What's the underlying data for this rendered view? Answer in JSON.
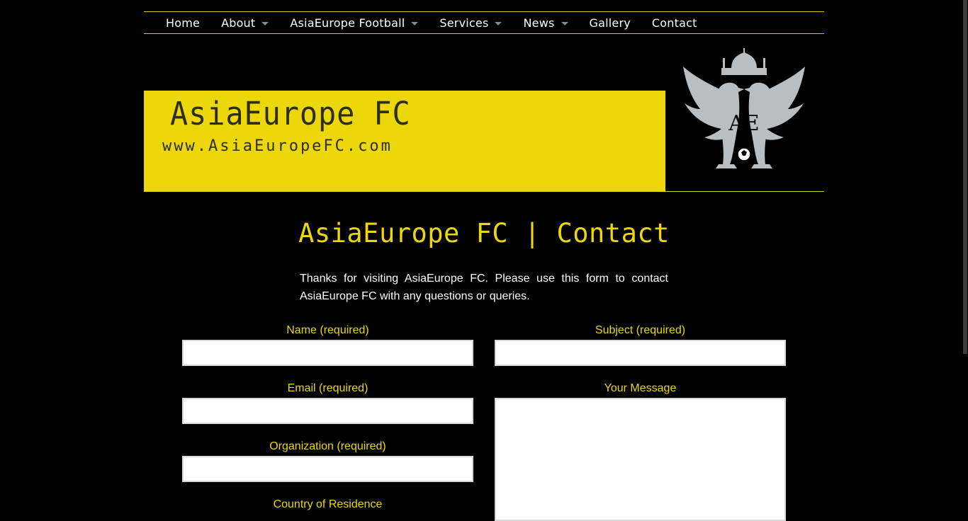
{
  "nav": {
    "items": [
      {
        "label": "Home",
        "has_dropdown": false
      },
      {
        "label": "About",
        "has_dropdown": true
      },
      {
        "label": "AsiaEurope Football",
        "has_dropdown": true
      },
      {
        "label": "Services",
        "has_dropdown": true
      },
      {
        "label": "News",
        "has_dropdown": true
      },
      {
        "label": "Gallery",
        "has_dropdown": false
      },
      {
        "label": "Contact",
        "has_dropdown": false
      }
    ]
  },
  "header": {
    "title": "AsiaEurope FC",
    "url": "www.AsiaEuropeFC.com",
    "logo_text": "AE"
  },
  "content": {
    "heading": "AsiaEurope FC | Contact",
    "intro": "Thanks for visiting AsiaEurope FC. Please use this form to contact AsiaEurope FC with any questions or queries."
  },
  "form": {
    "name_label": "Name (required)",
    "email_label": "Email (required)",
    "organization_label": "Organization (required)",
    "country_label": "Country of Residence",
    "subject_label": "Subject (required)",
    "message_label": "Your Message",
    "name_value": "",
    "email_value": "",
    "organization_value": "",
    "subject_value": "",
    "message_value": ""
  },
  "colors": {
    "accent_yellow": "#ecd70b",
    "background": "#000000",
    "logo_silver": "#b9bec3"
  }
}
